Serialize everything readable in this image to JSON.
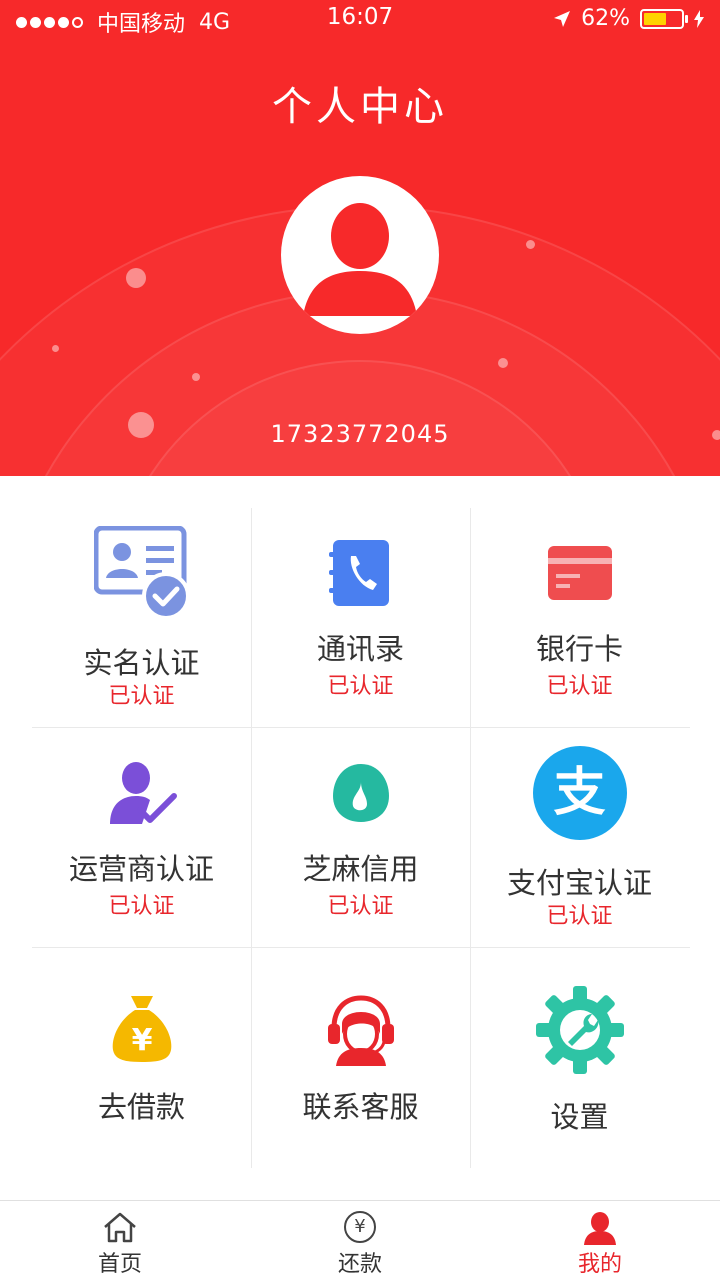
{
  "status_bar": {
    "carrier": "中国移动",
    "network": "4G",
    "time": "16:07",
    "battery": "62%",
    "battery_level": 0.62
  },
  "header": {
    "title": "个人中心",
    "phone": "17323772045"
  },
  "colors": {
    "header_bg": "#f7292a",
    "accent": "#e8262c",
    "id_icon": "#7b93e0",
    "contacts_icon": "#4a7ff0",
    "bank_icon": "#ef4d4f",
    "operator_icon": "#7b4fd8",
    "sesame_icon": "#25b9a0",
    "alipay_icon": "#1aa7ec",
    "loan_icon": "#f5b800",
    "service_icon": "#e8262c",
    "settings_icon": "#2ec4a5"
  },
  "grid": {
    "items": [
      {
        "label": "实名认证",
        "status": "已认证",
        "icon": "id-card-check-icon"
      },
      {
        "label": "通讯录",
        "status": "已认证",
        "icon": "phone-book-icon"
      },
      {
        "label": "银行卡",
        "status": "已认证",
        "icon": "bank-card-icon"
      },
      {
        "label": "运营商认证",
        "status": "已认证",
        "icon": "person-check-icon"
      },
      {
        "label": "芝麻信用",
        "status": "已认证",
        "icon": "sesame-credit-icon"
      },
      {
        "label": "支付宝认证",
        "status": "已认证",
        "icon": "alipay-icon"
      },
      {
        "label": "去借款",
        "status": "",
        "icon": "money-bag-icon"
      },
      {
        "label": "联系客服",
        "status": "",
        "icon": "customer-service-icon"
      },
      {
        "label": "设置",
        "status": "",
        "icon": "gear-wrench-icon"
      }
    ],
    "alipay_glyph": "支",
    "money_glyph": "¥"
  },
  "tabbar": {
    "tabs": [
      {
        "label": "首页",
        "icon": "home-icon"
      },
      {
        "label": "还款",
        "icon": "repay-icon",
        "glyph": "¥"
      },
      {
        "label": "我的",
        "icon": "user-icon",
        "active": true
      }
    ]
  }
}
